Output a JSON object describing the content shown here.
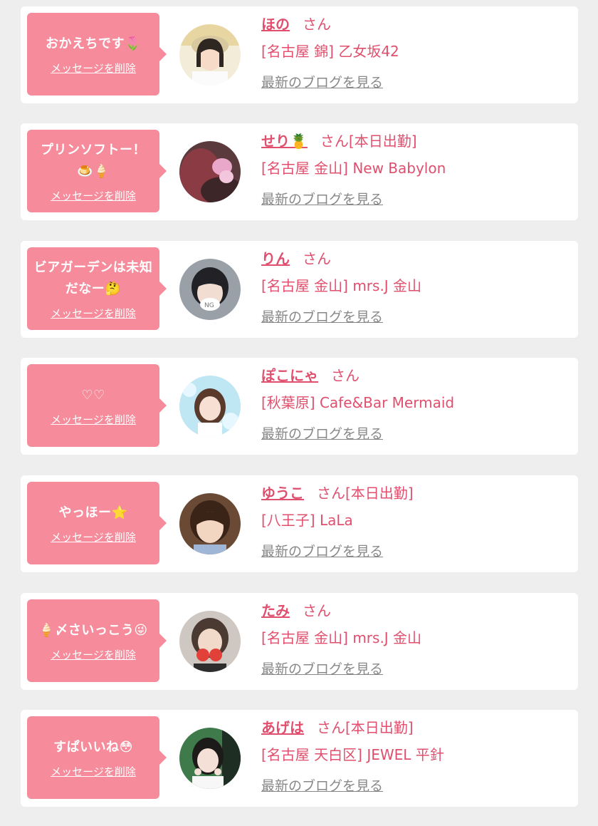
{
  "delete_label": "メッセージを削除",
  "blog_label": "最新のブログを見る",
  "colors": {
    "bubble": "#f58b9b",
    "name": "#e0506e",
    "link_gray": "#888888",
    "background": "#eeeeee"
  },
  "entries": [
    {
      "message": "おかえちです🌷",
      "name": "ほの",
      "suffix": "さん",
      "shop": "[名古屋 錦] 乙女坂42"
    },
    {
      "message": "プリンソフトー！🍮🍦",
      "name": "せり🍍",
      "suffix": "さん[本日出勤]",
      "shop": "[名古屋 金山] New Babylon"
    },
    {
      "message": "ビアガーデンは未知だなー🤔",
      "name": "りん",
      "suffix": "さん",
      "shop": "[名古屋 金山] mrs.J 金山"
    },
    {
      "message": "♡♡",
      "name": "ぽこにゃ",
      "suffix": "さん",
      "shop": "[秋葉原] Cafe&Bar Mermaid"
    },
    {
      "message": "やっほー⭐",
      "name": "ゆうこ",
      "suffix": "さん[本日出勤]",
      "shop": "[八王子] LaLa"
    },
    {
      "message": "🍦〆さいっこう😜",
      "name": "たみ",
      "suffix": "さん",
      "shop": "[名古屋 金山] mrs.J 金山"
    },
    {
      "message": "すぱいいね😳",
      "name": "あげは",
      "suffix": "さん[本日出勤]",
      "shop": "[名古屋 天白区] JEWEL 平針"
    }
  ]
}
